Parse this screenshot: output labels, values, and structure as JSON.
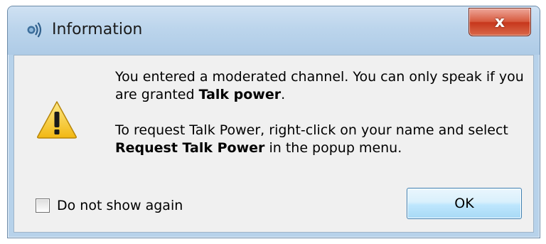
{
  "window": {
    "title": "Information",
    "title_icon": "teamspeak-icon",
    "close_icon": "close-icon",
    "close_glyph": "x"
  },
  "message": {
    "line1_prefix": "You entered a moderated channel. You can only speak if you are granted ",
    "line1_bold": "Talk power",
    "line1_suffix": ".",
    "line2_prefix": "To request Talk Power, right-click on your name and select ",
    "line2_bold": "Request Talk Power",
    "line2_suffix": " in the popup menu."
  },
  "icon": {
    "name": "warning-icon"
  },
  "checkbox": {
    "label": "Do not show again",
    "checked": false
  },
  "buttons": {
    "ok_label": "OK"
  },
  "colors": {
    "titlebar": "#bcd5ec",
    "close_button": "#d75a3e",
    "client_background": "#f0f0f0",
    "ok_button_border": "#3c7fb1",
    "warning_yellow": "#f7c525"
  }
}
